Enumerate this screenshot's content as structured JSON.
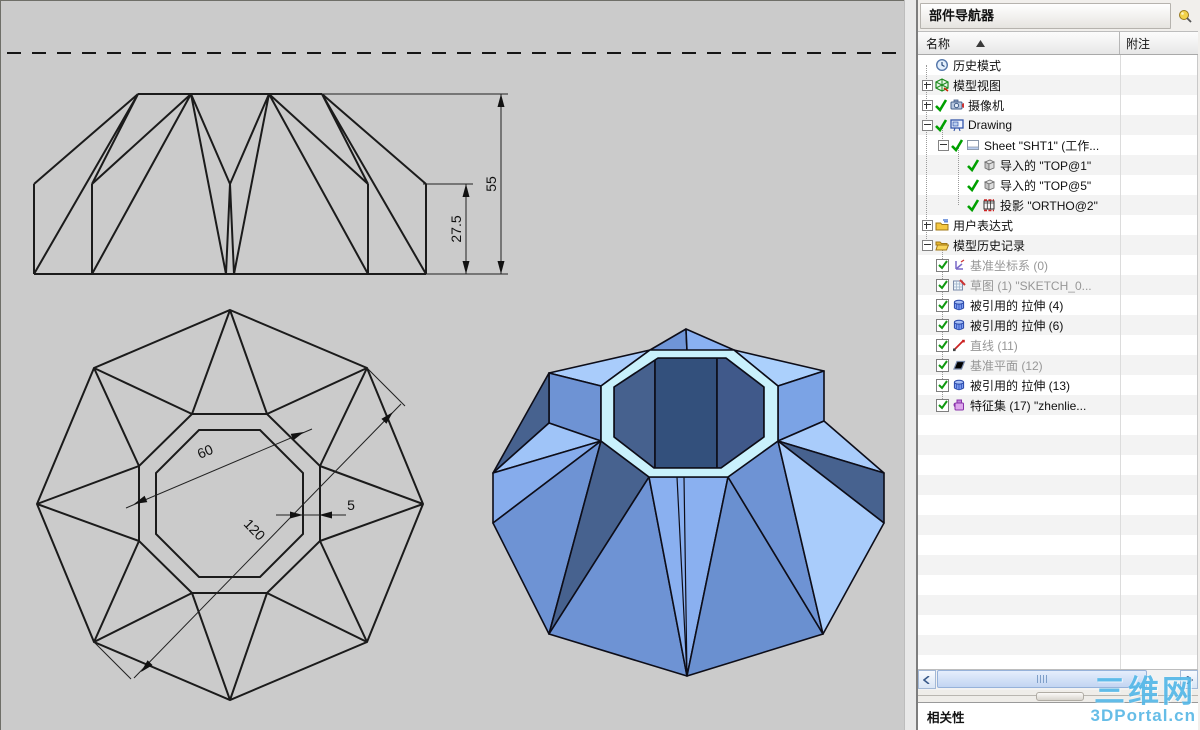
{
  "canvas": {
    "front_view": {
      "dim_total_height": "55",
      "dim_point_height": "27.5"
    },
    "top_view": {
      "dim_inner": "60",
      "dim_outer": "120",
      "dim_wall": "5"
    }
  },
  "colors": {
    "canvas_bg": "#cbcbcb",
    "model_ring_pale": "#c9f1fc",
    "model_light": "#a9ccfb",
    "model_medium": "#6e93d4",
    "model_dark": "#47628f",
    "model_hole_dark": "#33507c",
    "watermark_blue": "#55b8e8"
  },
  "panel": {
    "title": "部件导航器",
    "pin_icon": "pin-icon",
    "columns": [
      {
        "label": "名称"
      },
      {
        "label": "附注"
      }
    ],
    "tree": [
      {
        "label": "历史模式",
        "icon": "clock-icon",
        "expander": "none",
        "check": "none",
        "indent": 0,
        "muted": false
      },
      {
        "label": "模型视图",
        "icon": "model-views-icon",
        "expander": "plus",
        "check": "none",
        "indent": 0,
        "muted": false
      },
      {
        "label": "摄像机",
        "icon": "camera-icon",
        "expander": "plus",
        "check": "check",
        "indent": 0,
        "muted": false
      },
      {
        "label": "Drawing",
        "icon": "drawing-icon",
        "expander": "minus",
        "check": "check",
        "indent": 0,
        "muted": false
      },
      {
        "label": "Sheet \"SHT1\" (工作...",
        "icon": "sheet-icon",
        "expander": "minus",
        "check": "check",
        "indent": 1,
        "muted": false
      },
      {
        "label": "导入的 \"TOP@1\"",
        "icon": "imported-view-icon",
        "expander": "none",
        "check": "check",
        "indent": 2,
        "muted": false
      },
      {
        "label": "导入的 \"TOP@5\"",
        "icon": "imported-view-icon",
        "expander": "none",
        "check": "check",
        "indent": 2,
        "muted": false
      },
      {
        "label": "投影 \"ORTHO@2\"",
        "icon": "projection-icon",
        "expander": "none",
        "check": "check",
        "indent": 2,
        "muted": false
      },
      {
        "label": "用户表达式",
        "icon": "expressions-folder-icon",
        "expander": "plus",
        "check": "none",
        "indent": 0,
        "muted": false
      },
      {
        "label": "模型历史记录",
        "icon": "open-folder-icon",
        "expander": "minus",
        "check": "none",
        "indent": 0,
        "muted": false
      },
      {
        "label": "基准坐标系 (0)",
        "icon": "csys-icon",
        "expander": "none",
        "check": "checkbox",
        "indent": 1,
        "muted": true
      },
      {
        "label": "草图 (1) \"SKETCH_0...",
        "icon": "sketch-icon",
        "expander": "none",
        "check": "checkbox",
        "indent": 1,
        "muted": true
      },
      {
        "label": "被引用的 拉伸 (4)",
        "icon": "extrude-icon",
        "expander": "none",
        "check": "checkbox",
        "indent": 1,
        "muted": false
      },
      {
        "label": "被引用的 拉伸 (6)",
        "icon": "extrude-icon",
        "expander": "none",
        "check": "checkbox",
        "indent": 1,
        "muted": false
      },
      {
        "label": "直线 (11)",
        "icon": "line-icon",
        "expander": "none",
        "check": "checkbox",
        "indent": 1,
        "muted": true
      },
      {
        "label": "基准平面 (12)",
        "icon": "plane-icon",
        "expander": "none",
        "check": "checkbox",
        "indent": 1,
        "muted": true
      },
      {
        "label": "被引用的 拉伸 (13)",
        "icon": "extrude-icon",
        "expander": "none",
        "check": "checkbox",
        "indent": 1,
        "muted": false
      },
      {
        "label": "特征集 (17) \"zhenlie...",
        "icon": "feature-set-icon",
        "expander": "none",
        "check": "checkbox",
        "indent": 1,
        "muted": false
      }
    ],
    "dependencies_title": "相关性",
    "watermark_line1": "三维网",
    "watermark_line2": "3DPortal.cn"
  }
}
